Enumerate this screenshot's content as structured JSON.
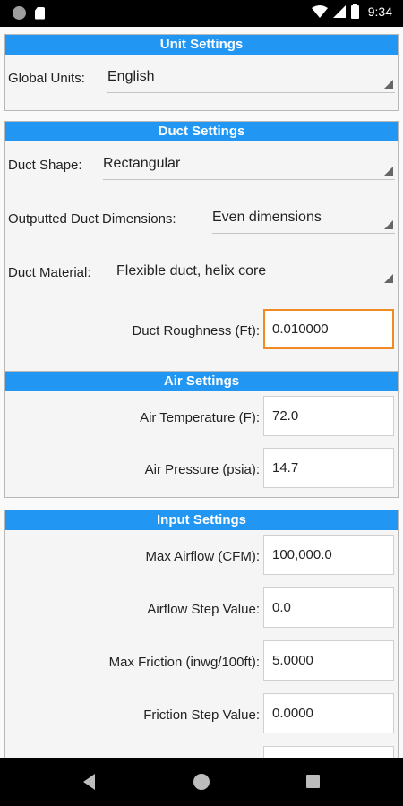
{
  "status_bar": {
    "time": "9:34"
  },
  "unit_settings": {
    "title": "Unit Settings",
    "global_units_label": "Global Units:",
    "global_units_value": "English"
  },
  "duct_settings": {
    "title": "Duct Settings",
    "shape_label": "Duct Shape:",
    "shape_value": "Rectangular",
    "dimensions_label": "Outputted Duct Dimensions:",
    "dimensions_value": "Even dimensions",
    "material_label": "Duct Material:",
    "material_value": "Flexible duct, helix core",
    "roughness_label": "Duct Roughness (Ft):",
    "roughness_value": "0.010000"
  },
  "air_settings": {
    "title": "Air Settings",
    "temperature_label": "Air Temperature (F):",
    "temperature_value": "72.0",
    "pressure_label": "Air Pressure (psia):",
    "pressure_value": "14.7"
  },
  "input_settings": {
    "title": "Input Settings",
    "max_airflow_label": "Max Airflow (CFM):",
    "max_airflow_value": "100,000.0",
    "airflow_step_label": "Airflow Step Value:",
    "airflow_step_value": "0.0",
    "max_friction_label": "Max Friction (inwg/100ft):",
    "max_friction_value": "5.0000",
    "friction_step_label": "Friction Step Value:",
    "friction_step_value": "0.0000"
  },
  "icons": {
    "status_left": [
      "circle-icon",
      "sim-card-icon"
    ],
    "status_right": [
      "wifi-icon",
      "signal-icon",
      "battery-icon"
    ],
    "nav": [
      "back-icon",
      "home-icon",
      "recents-icon"
    ]
  },
  "colors": {
    "header_blue": "#2196f3",
    "focus_orange": "#f08a24"
  }
}
